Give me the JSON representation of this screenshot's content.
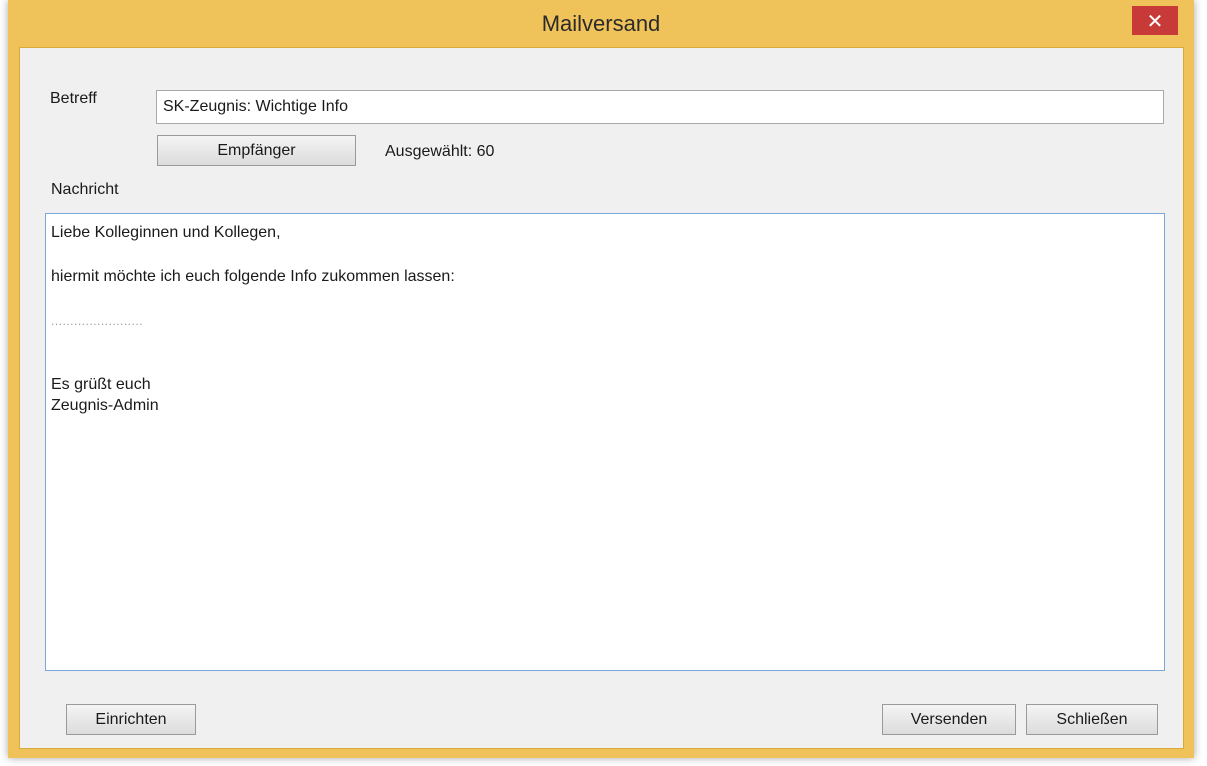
{
  "window": {
    "title": "Mailversand",
    "close_glyph": "✕",
    "accent_color": "#f0c35a",
    "close_color": "#c83a37"
  },
  "form": {
    "subject_label": "Betreff",
    "subject_value": "SK-Zeugnis: Wichtige Info",
    "recipients_button": "Empfänger",
    "selected_text": "Ausgewählt: 60",
    "message_label": "Nachricht",
    "message_lines": [
      "Liebe Kolleginnen und Kollegen,",
      "hiermit möchte ich euch folgende Info zukommen lassen:",
      "........................",
      "Es grüßt euch",
      "Zeugnis-Admin"
    ]
  },
  "buttons": {
    "setup": "Einrichten",
    "send": "Versenden",
    "close": "Schließen"
  }
}
